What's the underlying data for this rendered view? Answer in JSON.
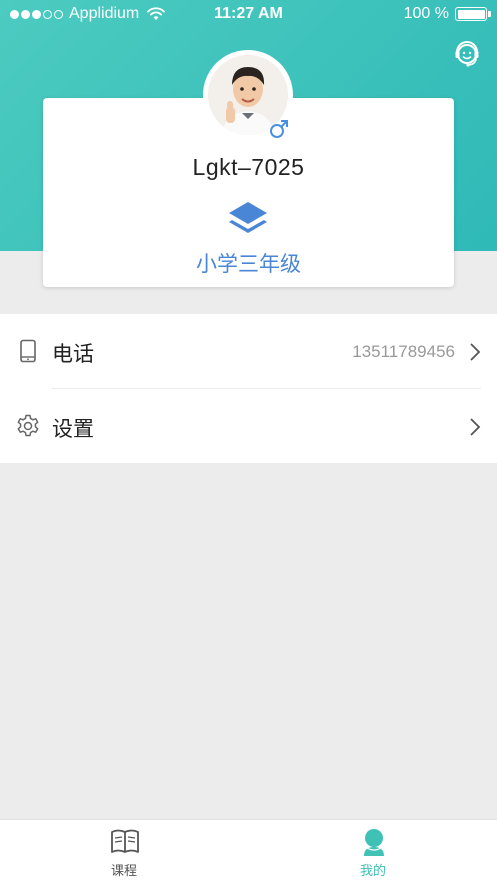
{
  "status_bar": {
    "carrier": "Applidium",
    "time": "11:27 AM",
    "battery": "100 %"
  },
  "profile": {
    "username": "Lgkt–7025",
    "grade": "小学三年级",
    "gender_icon": "male-symbol-icon"
  },
  "menu": {
    "items": [
      {
        "label": "电话",
        "value": "13511789456",
        "icon": "phone-icon"
      },
      {
        "label": "设置",
        "value": "",
        "icon": "gear-icon"
      }
    ]
  },
  "tabbar": {
    "tabs": [
      {
        "label": "课程",
        "icon": "book-icon",
        "active": false
      },
      {
        "label": "我的",
        "icon": "user-icon",
        "active": true
      }
    ]
  },
  "colors": {
    "header_start": "#4ccbc0",
    "header_end": "#2fb9b7",
    "grade_blue": "#4a86d6",
    "active_tab": "#3fc1b6",
    "page_bg": "#ececec"
  }
}
